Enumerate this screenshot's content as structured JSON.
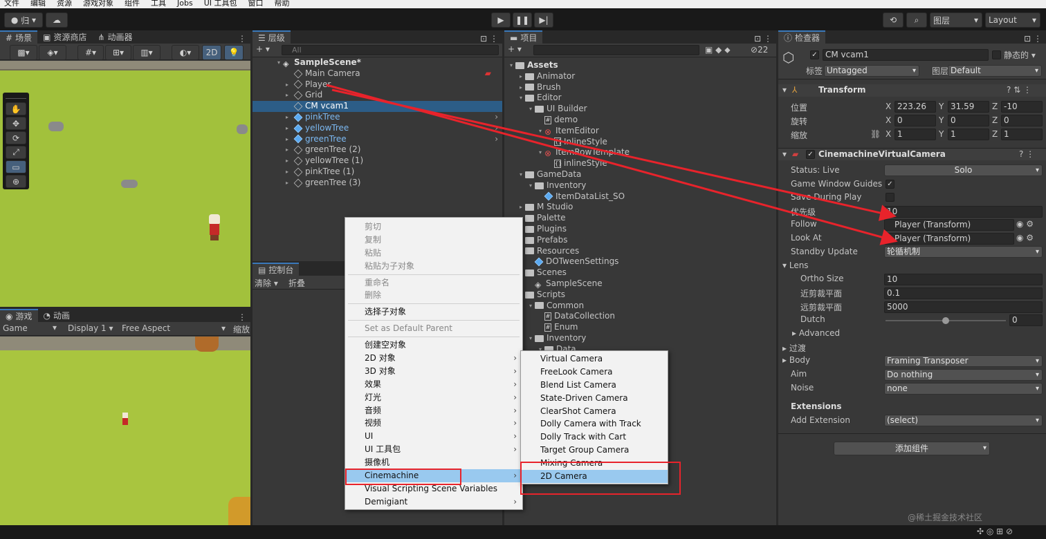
{
  "menubar": [
    "文件",
    "编辑",
    "资源",
    "游戏对象",
    "组件",
    "工具",
    "Jobs",
    "UI 工具包",
    "窗口",
    "帮助"
  ],
  "toolbar": {
    "account": "归",
    "layers": "图层",
    "layout": "Layout"
  },
  "scene": {
    "tab_scene": "场景",
    "tab_store": "资源商店",
    "tab_animator": "动画器",
    "mode_2d": "2D"
  },
  "game": {
    "tab_game": "游戏",
    "tab_anim": "动画",
    "mode": "Game",
    "display": "Display 1",
    "aspect": "Free Aspect",
    "scale": "缩放"
  },
  "hierarchy": {
    "tab": "层级",
    "search_placeholder": "All",
    "scene": "SampleScene*",
    "items": [
      {
        "label": "Main Camera",
        "type": "normal"
      },
      {
        "label": "Player",
        "type": "normal"
      },
      {
        "label": "Grid",
        "type": "normal"
      },
      {
        "label": "CM vcam1",
        "type": "selected"
      },
      {
        "label": "pinkTree",
        "type": "prefab"
      },
      {
        "label": "yellowTree",
        "type": "prefab"
      },
      {
        "label": "greenTree",
        "type": "prefab"
      },
      {
        "label": "greenTree (2)",
        "type": "normal"
      },
      {
        "label": "yellowTree (1)",
        "type": "normal"
      },
      {
        "label": "pinkTree (1)",
        "type": "normal"
      },
      {
        "label": "greenTree (3)",
        "type": "normal"
      }
    ]
  },
  "console": {
    "tab": "控制台",
    "clear": "清除",
    "collapse": "折叠"
  },
  "project": {
    "tab": "项目",
    "hidden_count": "22",
    "items": [
      {
        "label": "Assets",
        "indent": 0,
        "icon": "folder",
        "bold": true
      },
      {
        "label": "Animator",
        "indent": 1,
        "icon": "folder"
      },
      {
        "label": "Brush",
        "indent": 1,
        "icon": "folder"
      },
      {
        "label": "Editor",
        "indent": 1,
        "icon": "folder"
      },
      {
        "label": "UI Builder",
        "indent": 2,
        "icon": "folder"
      },
      {
        "label": "demo",
        "indent": 3,
        "icon": "script"
      },
      {
        "label": "ItemEditor",
        "indent": 3,
        "icon": "uxml"
      },
      {
        "label": "InlineStyle",
        "indent": 4,
        "icon": "style"
      },
      {
        "label": "ItemRowTemplate",
        "indent": 3,
        "icon": "uxml"
      },
      {
        "label": "inlineStyle",
        "indent": 4,
        "icon": "style"
      },
      {
        "label": "GameData",
        "indent": 1,
        "icon": "folder"
      },
      {
        "label": "Inventory",
        "indent": 2,
        "icon": "folder"
      },
      {
        "label": "ItemDataList_SO",
        "indent": 3,
        "icon": "asset"
      },
      {
        "label": "M Studio",
        "indent": 1,
        "icon": "folder"
      },
      {
        "label": "Palette",
        "indent": 1,
        "icon": "folder"
      },
      {
        "label": "Plugins",
        "indent": 1,
        "icon": "folder"
      },
      {
        "label": "Prefabs",
        "indent": 1,
        "icon": "folder"
      },
      {
        "label": "Resources",
        "indent": 1,
        "icon": "folder"
      },
      {
        "label": "DOTweenSettings",
        "indent": 2,
        "icon": "asset"
      },
      {
        "label": "Scenes",
        "indent": 1,
        "icon": "folder"
      },
      {
        "label": "SampleScene",
        "indent": 2,
        "icon": "unity"
      },
      {
        "label": "Scripts",
        "indent": 1,
        "icon": "folder"
      },
      {
        "label": "Common",
        "indent": 2,
        "icon": "folder"
      },
      {
        "label": "DataCollection",
        "indent": 3,
        "icon": "script"
      },
      {
        "label": "Enum",
        "indent": 3,
        "icon": "script"
      },
      {
        "label": "Inventory",
        "indent": 2,
        "icon": "folder"
      },
      {
        "label": "Data",
        "indent": 3,
        "icon": "folder"
      }
    ]
  },
  "inspector": {
    "tab": "检查器",
    "object_name": "CM vcam1",
    "static_label": "静态的",
    "tag_label": "标签",
    "tag_value": "Untagged",
    "layer_label": "图层",
    "layer_value": "Default",
    "transform_title": "Transform",
    "pos_label": "位置",
    "rot_label": "旋转",
    "scale_label": "缩放",
    "x": "X",
    "y": "Y",
    "z": "Z",
    "pos": [
      "223.26",
      "31.59",
      "-10"
    ],
    "rot": [
      "0",
      "0",
      "0"
    ],
    "scl": [
      "1",
      "1",
      "1"
    ],
    "vcam_title": "CinemachineVirtualCamera",
    "status_label": "Status: Live",
    "solo": "Solo",
    "guides_label": "Game Window Guides",
    "save_label": "Save During Play",
    "priority_label": "优先级",
    "priority_value": "10",
    "follow_label": "Follow",
    "follow_value": "Player (Transform)",
    "lookat_label": "Look At",
    "lookat_value": "Player (Transform)",
    "standby_label": "Standby Update",
    "standby_value": "轮循机制",
    "lens_label": "Lens",
    "ortho_label": "Ortho Size",
    "ortho_value": "10",
    "near_label": "近剪裁平面",
    "near_value": "0.1",
    "far_label": "远剪裁平面",
    "far_value": "5000",
    "dutch_label": "Dutch",
    "dutch_value": "0",
    "dutch_fraction": 0.5,
    "advanced_label": "Advanced",
    "transition_label": "过渡",
    "body_label": "Body",
    "body_value": "Framing Transposer",
    "aim_label": "Aim",
    "aim_value": "Do nothing",
    "noise_label": "Noise",
    "noise_value": "none",
    "ext_label": "Extensions",
    "addext_label": "Add Extension",
    "addext_value": "(select)",
    "add_component": "添加组件"
  },
  "context_menu": {
    "items": [
      {
        "label": "剪切",
        "state": "disabled"
      },
      {
        "label": "复制",
        "state": "disabled"
      },
      {
        "label": "粘贴",
        "state": "disabled"
      },
      {
        "label": "粘贴为子对象",
        "state": "disabled"
      },
      {
        "sep": true
      },
      {
        "label": "重命名",
        "state": "disabled"
      },
      {
        "label": "删除",
        "state": "disabled"
      },
      {
        "sep": true
      },
      {
        "label": "选择子对象",
        "state": "normal"
      },
      {
        "sep": true
      },
      {
        "label": "Set as Default Parent",
        "state": "disabled"
      },
      {
        "sep": true
      },
      {
        "label": "创建空对象",
        "state": "normal"
      },
      {
        "label": "2D 对象",
        "state": "normal",
        "sub": true
      },
      {
        "label": "3D 对象",
        "state": "normal",
        "sub": true
      },
      {
        "label": "效果",
        "state": "normal",
        "sub": true
      },
      {
        "label": "灯光",
        "state": "normal",
        "sub": true
      },
      {
        "label": "音频",
        "state": "normal",
        "sub": true
      },
      {
        "label": "视频",
        "state": "normal",
        "sub": true
      },
      {
        "label": "UI",
        "state": "normal",
        "sub": true
      },
      {
        "label": "UI 工具包",
        "state": "normal",
        "sub": true
      },
      {
        "label": "摄像机",
        "state": "normal"
      },
      {
        "label": "Cinemachine",
        "state": "selected",
        "sub": true
      },
      {
        "label": "Visual Scripting Scene Variables",
        "state": "normal"
      },
      {
        "label": "Demigiant",
        "state": "normal",
        "sub": true
      }
    ]
  },
  "submenu": {
    "items": [
      {
        "label": "Virtual Camera",
        "state": "normal"
      },
      {
        "label": "FreeLook Camera",
        "state": "normal"
      },
      {
        "label": "Blend List Camera",
        "state": "normal"
      },
      {
        "label": "State-Driven Camera",
        "state": "normal"
      },
      {
        "label": "ClearShot Camera",
        "state": "normal"
      },
      {
        "label": "Dolly Camera with Track",
        "state": "normal"
      },
      {
        "label": "Dolly Track with Cart",
        "state": "normal"
      },
      {
        "label": "Target Group Camera",
        "state": "normal"
      },
      {
        "label": "Mixing Camera",
        "state": "normal"
      },
      {
        "label": "2D Camera",
        "state": "selected"
      }
    ]
  },
  "watermark": "@稀土掘金技术社区",
  "colors": {
    "selection": "#2c5d87",
    "accent": "#3a79bb",
    "annotation": "#e8232b",
    "menu_highlight": "#99c9ef"
  }
}
